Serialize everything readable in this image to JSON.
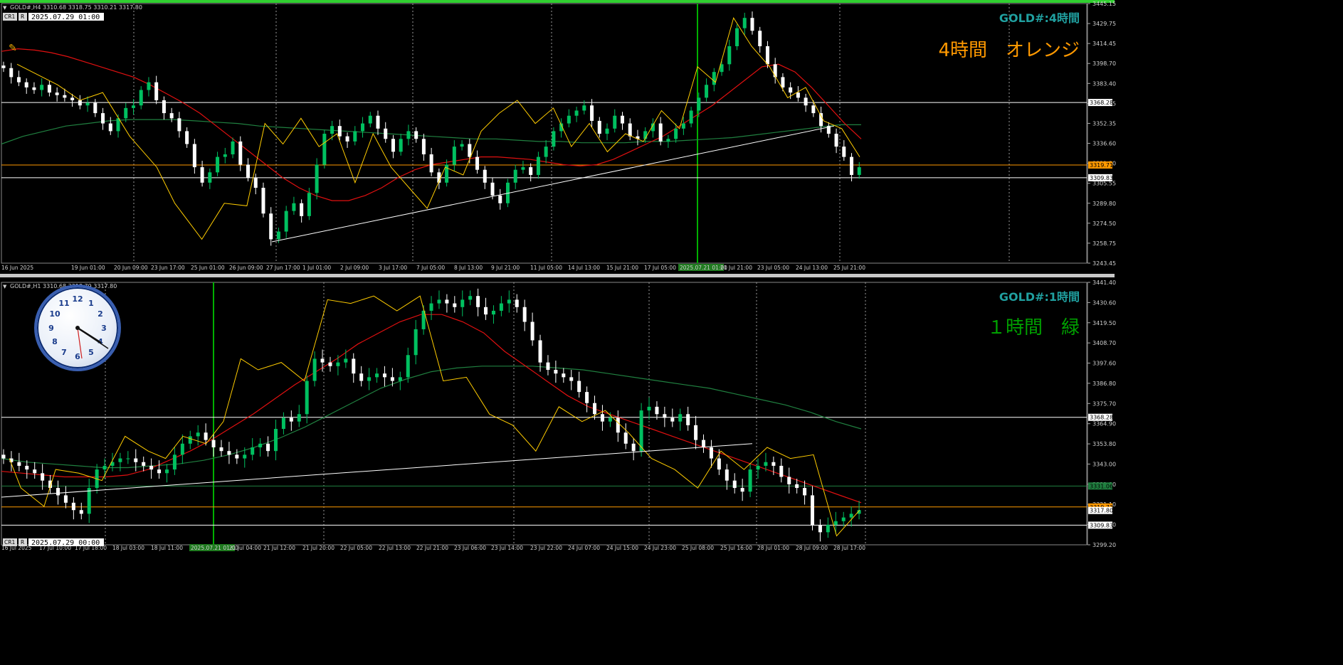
{
  "colors": {
    "background": "#000000",
    "candle_bull": "#00c060",
    "candle_bear": "#ffffff",
    "ma_red": "#e01010",
    "ma_green": "#208040",
    "zigzag": "#ffcc00",
    "hline_white": "#ffffff",
    "hline_orange": "#ff9900",
    "vline_green": "#00b000",
    "title_teal": "#20a0a0",
    "label_orange": "#ff9900",
    "label_green": "#00a000"
  },
  "chart_data": [
    {
      "type": "candlestick",
      "symbol_info": "GOLD#,H4  3310.68 3318.75 3310.21 3317.80",
      "mode_label": "CR1",
      "r_label": "R",
      "crosshair_time": "2025.07.29 01:00",
      "title": "GOLD#:4時間",
      "annotation": "4時間　オレンジ",
      "ylim": [
        3243.45,
        3445.15
      ],
      "y_ticks": [
        "3445.15",
        "3429.75",
        "3414.45",
        "3398.70",
        "3383.40",
        "3367.65",
        "3352.35",
        "3336.60",
        "3321.30",
        "3305.55",
        "3289.80",
        "3274.50",
        "3258.75",
        "3243.45"
      ],
      "price_tags": [
        {
          "value": 3368.28,
          "label": "3368.28",
          "style": "white"
        },
        {
          "value": 3319.71,
          "label": "3319.71",
          "style": "orange"
        },
        {
          "value": 3309.83,
          "label": "3309.83",
          "style": "white"
        }
      ],
      "x_labels": [
        "16 Jun 2025",
        "19 Jun 01:00",
        "20 Jun 09:00",
        "23 Jun 17:00",
        "25 Jun 01:00",
        "26 Jun 09:00",
        "27 Jun 17:00",
        "1 Jul 01:00",
        "2 Jul 09:00",
        "3 Jul 17:00",
        "7 Jul 05:00",
        "8 Jul 13:00",
        "9 Jul 21:00",
        "11 Jul 05:00",
        "14 Jul 13:00",
        "15 Jul 21:00",
        "17 Jul 05:00",
        "2025.07.21 01:00",
        "21 Jul 21:00",
        "23 Jul 05:00",
        "24 Jul 13:00",
        "25 Jul 21:00"
      ],
      "closes": [
        3395,
        3388,
        3384,
        3380,
        3378,
        3382,
        3376,
        3374,
        3372,
        3370,
        3366,
        3368,
        3360,
        3352,
        3346,
        3356,
        3364,
        3366,
        3378,
        3384,
        3370,
        3360,
        3356,
        3346,
        3336,
        3318,
        3306,
        3314,
        3326,
        3328,
        3338,
        3320,
        3310,
        3302,
        3282,
        3262,
        3268,
        3284,
        3290,
        3280,
        3298,
        3320,
        3344,
        3350,
        3342,
        3338,
        3346,
        3352,
        3358,
        3348,
        3340,
        3330,
        3340,
        3346,
        3340,
        3328,
        3314,
        3306,
        3320,
        3334,
        3336,
        3326,
        3316,
        3306,
        3296,
        3290,
        3306,
        3316,
        3318,
        3312,
        3326,
        3334,
        3346,
        3352,
        3358,
        3362,
        3366,
        3354,
        3344,
        3348,
        3358,
        3352,
        3342,
        3340,
        3346,
        3352,
        3338,
        3340,
        3348,
        3352,
        3362,
        3372,
        3382,
        3392,
        3398,
        3412,
        3426,
        3434,
        3424,
        3412,
        3398,
        3388,
        3380,
        3376,
        3372,
        3366,
        3360,
        3350,
        3344,
        3334,
        3326,
        3312,
        3318
      ],
      "ma_red": [
        3408,
        3410,
        3409,
        3407,
        3404,
        3400,
        3396,
        3392,
        3388,
        3382,
        3375,
        3368,
        3360,
        3350,
        3340,
        3330,
        3320,
        3310,
        3302,
        3296,
        3292,
        3292,
        3296,
        3302,
        3310,
        3316,
        3320,
        3322,
        3324,
        3326,
        3326,
        3325,
        3324,
        3322,
        3320,
        3319,
        3320,
        3324,
        3330,
        3336,
        3342,
        3350,
        3358,
        3366,
        3376,
        3386,
        3396,
        3398,
        3392,
        3380,
        3366,
        3352,
        3340
      ],
      "ma_green": [
        3336,
        3342,
        3346,
        3350,
        3352,
        3354,
        3355,
        3355,
        3355,
        3354,
        3353,
        3352,
        3350,
        3349,
        3348,
        3347,
        3346,
        3345,
        3344,
        3343,
        3342,
        3341,
        3340,
        3340,
        3339,
        3338,
        3338,
        3337,
        3337,
        3337,
        3338,
        3338,
        3339,
        3340,
        3341,
        3343,
        3345,
        3347,
        3349,
        3351,
        3351
      ],
      "zigzag": [
        [
          3,
          3398
        ],
        [
          12,
          3382
        ],
        [
          17,
          3370
        ],
        [
          22,
          3376
        ],
        [
          28,
          3342
        ],
        [
          34,
          3318
        ],
        [
          38,
          3290
        ],
        [
          44,
          3262
        ],
        [
          49,
          3290
        ],
        [
          54,
          3288
        ],
        [
          58,
          3352
        ],
        [
          62,
          3336
        ],
        [
          66,
          3356
        ],
        [
          70,
          3334
        ],
        [
          74,
          3344
        ],
        [
          78,
          3306
        ],
        [
          82,
          3344
        ],
        [
          86,
          3318
        ],
        [
          90,
          3302
        ],
        [
          94,
          3286
        ],
        [
          98,
          3318
        ],
        [
          102,
          3312
        ],
        [
          106,
          3346
        ],
        [
          110,
          3360
        ],
        [
          114,
          3370
        ],
        [
          118,
          3352
        ],
        [
          122,
          3364
        ],
        [
          126,
          3334
        ],
        [
          130,
          3352
        ],
        [
          134,
          3330
        ],
        [
          138,
          3344
        ],
        [
          142,
          3338
        ],
        [
          146,
          3362
        ],
        [
          150,
          3348
        ],
        [
          154,
          3396
        ],
        [
          158,
          3384
        ],
        [
          162,
          3434
        ],
        [
          166,
          3412
        ],
        [
          170,
          3396
        ],
        [
          174,
          3372
        ],
        [
          178,
          3380
        ],
        [
          182,
          3354
        ],
        [
          186,
          3348
        ],
        [
          190,
          3326
        ]
      ],
      "trendline": [
        [
          3260,
          0.2445
        ],
        [
          3350,
          0.9722
        ]
      ],
      "hline_green_slot": 0.579
    },
    {
      "type": "candlestick",
      "symbol_info": "GOLD#,H1  3310.68 3318.79 3317.80",
      "mode_label": "CR1",
      "r_label": "R",
      "crosshair_time": "2025.07.29 00:00",
      "title": "GOLD#:1時間",
      "annotation": "１時間　緑",
      "ylim": [
        3299.2,
        3441.4
      ],
      "y_ticks": [
        "3441.40",
        "3430.60",
        "3419.50",
        "3408.70",
        "3397.60",
        "3386.80",
        "3375.70",
        "3364.90",
        "3353.80",
        "3343.00",
        "3331.90",
        "3321.10",
        "3310.00",
        "3299.20"
      ],
      "price_tags": [
        {
          "value": 3368.28,
          "label": "3368.28",
          "style": "white"
        },
        {
          "value": 3331.06,
          "label": "3331.06",
          "style": "green"
        },
        {
          "value": 3319.71,
          "label": "3319.71",
          "style": "orange"
        },
        {
          "value": 3317.8,
          "label": "3317.80",
          "style": "white"
        },
        {
          "value": 3309.83,
          "label": "3309.83",
          "style": "white"
        }
      ],
      "x_labels": [
        "16 Jul 2025",
        "17 Jul 10:00",
        "17 Jul 18:00",
        "18 Jul 03:00",
        "18 Jul 11:00",
        "2025.07.21 01:00",
        "21 Jul 04:00",
        "21 Jul 12:00",
        "21 Jul 20:00",
        "22 Jul 05:00",
        "22 Jul 13:00",
        "22 Jul 21:00",
        "23 Jul 06:00",
        "23 Jul 14:00",
        "23 Jul 22:00",
        "24 Jul 07:00",
        "24 Jul 15:00",
        "24 Jul 23:00",
        "25 Jul 08:00",
        "25 Jul 16:00",
        "28 Jul 01:00",
        "28 Jul 09:00",
        "28 Jul 17:00"
      ],
      "closes": [
        3346,
        3344,
        3342,
        3340,
        3338,
        3334,
        3330,
        3326,
        3322,
        3318,
        3316,
        3330,
        3340,
        3342,
        3344,
        3346,
        3346,
        3344,
        3342,
        3340,
        3338,
        3340,
        3348,
        3354,
        3358,
        3360,
        3356,
        3352,
        3350,
        3348,
        3346,
        3348,
        3352,
        3354,
        3350,
        3362,
        3368,
        3366,
        3370,
        3388,
        3400,
        3398,
        3396,
        3398,
        3400,
        3392,
        3388,
        3390,
        3392,
        3390,
        3388,
        3390,
        3402,
        3416,
        3426,
        3430,
        3432,
        3430,
        3428,
        3432,
        3434,
        3428,
        3424,
        3426,
        3430,
        3432,
        3428,
        3420,
        3410,
        3398,
        3394,
        3392,
        3390,
        3388,
        3382,
        3376,
        3370,
        3366,
        3368,
        3360,
        3354,
        3350,
        3372,
        3374,
        3370,
        3368,
        3366,
        3370,
        3364,
        3356,
        3352,
        3346,
        3340,
        3334,
        3330,
        3328,
        3340,
        3342,
        3344,
        3342,
        3336,
        3332,
        3330,
        3326,
        3310,
        3306,
        3310,
        3312,
        3314,
        3316,
        3318
      ],
      "ma_red": [
        3339,
        3338,
        3337,
        3336,
        3336,
        3336,
        3337,
        3340,
        3345,
        3350,
        3356,
        3363,
        3370,
        3378,
        3386,
        3393,
        3400,
        3408,
        3414,
        3420,
        3424,
        3424,
        3420,
        3414,
        3404,
        3396,
        3388,
        3380,
        3374,
        3370,
        3366,
        3362,
        3358,
        3354,
        3350,
        3346,
        3342,
        3338,
        3334,
        3330,
        3326,
        3322
      ],
      "ma_green": [
        3346,
        3344,
        3343,
        3342,
        3341,
        3341,
        3342,
        3343,
        3345,
        3348,
        3352,
        3357,
        3363,
        3370,
        3377,
        3384,
        3389,
        3393,
        3395,
        3396,
        3396,
        3396,
        3395,
        3394,
        3392,
        3390,
        3388,
        3386,
        3384,
        3381,
        3378,
        3375,
        3371,
        3366,
        3362
      ],
      "zigzag": [
        [
          1,
          3346
        ],
        [
          3,
          3330
        ],
        [
          7,
          3320
        ],
        [
          9,
          3340
        ],
        [
          13,
          3338
        ],
        [
          17,
          3334
        ],
        [
          21,
          3358
        ],
        [
          25,
          3350
        ],
        [
          28,
          3346
        ],
        [
          31,
          3358
        ],
        [
          35,
          3354
        ],
        [
          38,
          3366
        ],
        [
          41,
          3400
        ],
        [
          44,
          3394
        ],
        [
          48,
          3398
        ],
        [
          52,
          3388
        ],
        [
          56,
          3432
        ],
        [
          60,
          3430
        ],
        [
          64,
          3434
        ],
        [
          68,
          3426
        ],
        [
          72,
          3434
        ],
        [
          76,
          3388
        ],
        [
          80,
          3390
        ],
        [
          84,
          3370
        ],
        [
          88,
          3364
        ],
        [
          92,
          3350
        ],
        [
          96,
          3374
        ],
        [
          100,
          3366
        ],
        [
          104,
          3372
        ],
        [
          108,
          3360
        ],
        [
          112,
          3346
        ],
        [
          116,
          3340
        ],
        [
          120,
          3330
        ],
        [
          124,
          3350
        ],
        [
          128,
          3340
        ],
        [
          132,
          3352
        ],
        [
          136,
          3346
        ],
        [
          140,
          3348
        ],
        [
          144,
          3304
        ],
        [
          148,
          3318
        ]
      ],
      "trendline": [
        [
          3325,
          0.0
        ],
        [
          3354,
          0.7174
        ]
      ]
    }
  ]
}
